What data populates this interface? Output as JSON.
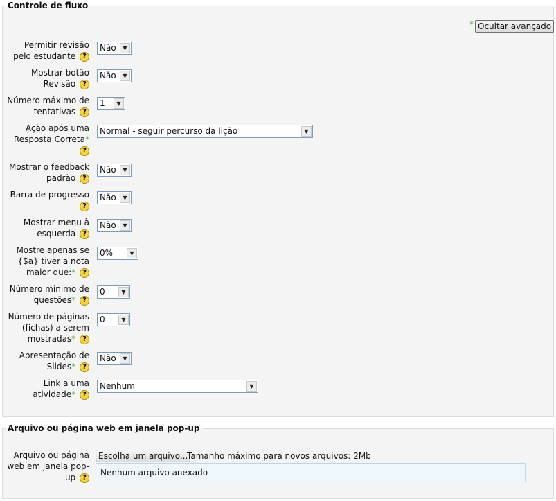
{
  "section1": {
    "legend": "Controle de fluxo",
    "advanced_button": "Ocultar avançado",
    "required_mark": "*",
    "help_glyph": "?",
    "fields": [
      {
        "label": "Permitir revisão pelo estudante",
        "value": "Não"
      },
      {
        "label": "Mostrar botão Revisão",
        "value": "Não"
      },
      {
        "label": "Número máximo de tentativas",
        "value": "1"
      },
      {
        "label": "Ação após uma Resposta Correta",
        "value": "Normal - seguir percurso da lição"
      },
      {
        "label": "Mostrar o feedback padrão",
        "value": "Não"
      },
      {
        "label": "Barra de progresso",
        "value": "Não"
      },
      {
        "label": "Mostrar menu à esquerda",
        "value": "Não"
      },
      {
        "label": "Mostre apenas se {$a} tiver a nota maior que:",
        "value": "0%"
      },
      {
        "label": "Número mínimo de questões",
        "value": "0"
      },
      {
        "label": "Número de páginas (fichas) a serem mostradas",
        "value": "0"
      },
      {
        "label": "Apresentação de Slides",
        "value": "Não"
      },
      {
        "label": "Link a uma atividade",
        "value": "Nenhum"
      }
    ]
  },
  "section2": {
    "legend": "Arquivo ou página web em janela pop-up",
    "field_label": "Arquivo ou página web em janela pop-up",
    "choose_button": "Escolha um arquivo...",
    "max_size": "Tamanho máximo para novos arquivos: 2Mb",
    "no_file": "Nenhum arquivo anexado"
  },
  "colors": {
    "required_star": "#4fb150",
    "help_icon": "#f6d53a",
    "fieldset_bg": "#f4f4f4",
    "filebox_bg": "#eef8fc"
  }
}
